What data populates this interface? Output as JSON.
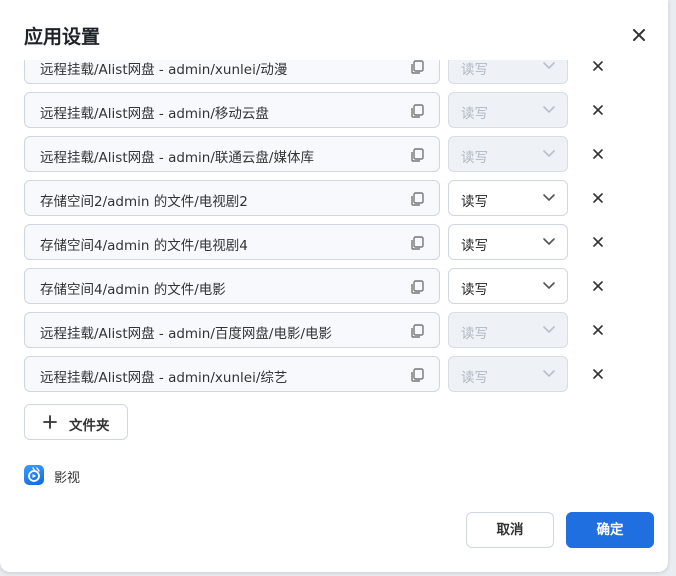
{
  "dialog": {
    "title": "应用设置",
    "add_folder_label": "文件夹",
    "app_name": "影视",
    "cancel_label": "取消",
    "confirm_label": "确定"
  },
  "rows": [
    {
      "path": "远程挂载/Alist网盘 - admin/xunlei/动漫",
      "permission": "读写",
      "disabled": true
    },
    {
      "path": "远程挂载/Alist网盘 - admin/移动云盘",
      "permission": "读写",
      "disabled": true
    },
    {
      "path": "远程挂载/Alist网盘 - admin/联通云盘/媒体库",
      "permission": "读写",
      "disabled": true
    },
    {
      "path": "存储空间2/admin 的文件/电视剧2",
      "permission": "读写",
      "disabled": false
    },
    {
      "path": "存储空间4/admin 的文件/电视剧4",
      "permission": "读写",
      "disabled": false
    },
    {
      "path": "存储空间4/admin 的文件/电影",
      "permission": "读写",
      "disabled": false
    },
    {
      "path": "远程挂载/Alist网盘 - admin/百度网盘/电影/电影",
      "permission": "读写",
      "disabled": true
    },
    {
      "path": "远程挂载/Alist网盘 - admin/xunlei/综艺",
      "permission": "读写",
      "disabled": true
    }
  ],
  "colors": {
    "accent": "#1f6fe0",
    "border": "#cfd6e0",
    "disabled_bg": "#eef1f5"
  },
  "icons": {
    "close": "close-icon",
    "copy": "copy-icon",
    "chevron": "chevron-down-icon",
    "plus": "plus-icon",
    "app": "video-app-icon"
  }
}
